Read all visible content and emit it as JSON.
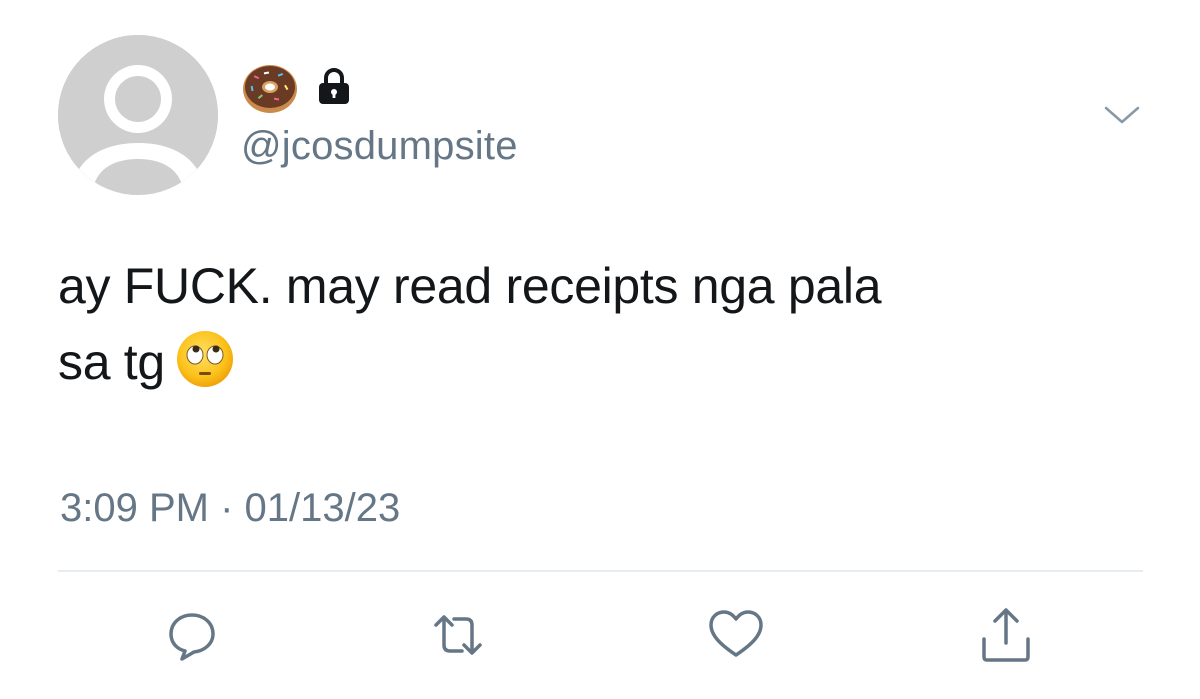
{
  "tweet": {
    "avatar_icon": "default-avatar-silhouette",
    "name_icons": [
      "donut-icon",
      "lock-icon"
    ],
    "handle": "@jcosdumpsite",
    "text_line1": "ay FUCK. may read receipts nga pala",
    "text_line2": "sa tg",
    "text_emoji": "face-with-rolling-eyes-emoji",
    "timestamp": "3:09 PM · 01/13/23"
  },
  "actions": [
    "reply-icon",
    "retweet-icon",
    "like-icon",
    "share-icon"
  ],
  "colors": {
    "text": "#14171a",
    "secondary": "#657786",
    "divider": "#e6ecf0",
    "avatar_bg": "#cdcdcd"
  }
}
